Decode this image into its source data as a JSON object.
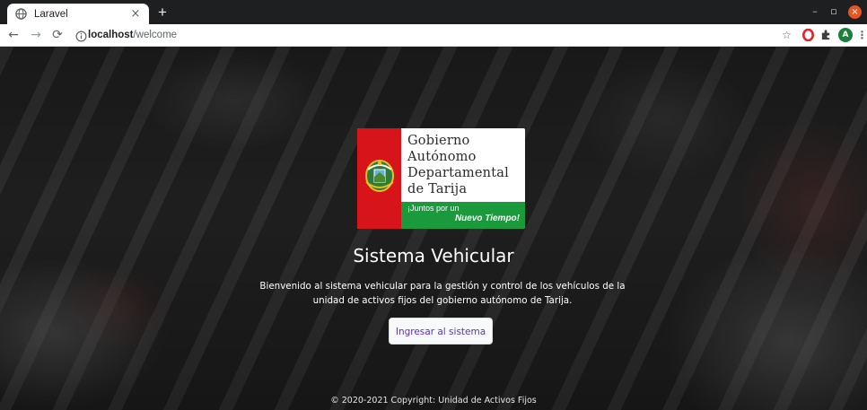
{
  "browser": {
    "tab": {
      "title": "Laravel",
      "close": "×",
      "favicon": "globe-icon"
    },
    "new_tab": "+",
    "window_controls": {
      "minimize": "–",
      "maximize": "▫",
      "close": "×"
    },
    "address": {
      "host": "localhost",
      "path": "/welcome"
    },
    "toolbar_icons": [
      "back-icon",
      "forward-icon",
      "reload-icon",
      "info-icon",
      "star-icon",
      "opera-icon",
      "extension-icon",
      "profile-icon",
      "menu-icon"
    ],
    "profile_initial": "A"
  },
  "page": {
    "logo": {
      "name_lines": [
        "Gobierno",
        "Autónomo",
        "Departamental",
        "de Tarija"
      ],
      "slogan_line1": "¡Juntos por un",
      "slogan_line2": "Nuevo Tiempo!"
    },
    "heading": "Sistema Vehicular",
    "description": "Bienvenido al sistema vehicular para la gestión y control de los vehículos de la unidad de activos fijos del gobierno autónomo de Tarija.",
    "cta_label": "Ingresar al sistema",
    "footer": "© 2020-2021 Copyright: Unidad de Activos Fijos"
  },
  "colors": {
    "brand_red": "#d7141a",
    "brand_green": "#1a9a3c",
    "button_text": "#5a31c7"
  }
}
